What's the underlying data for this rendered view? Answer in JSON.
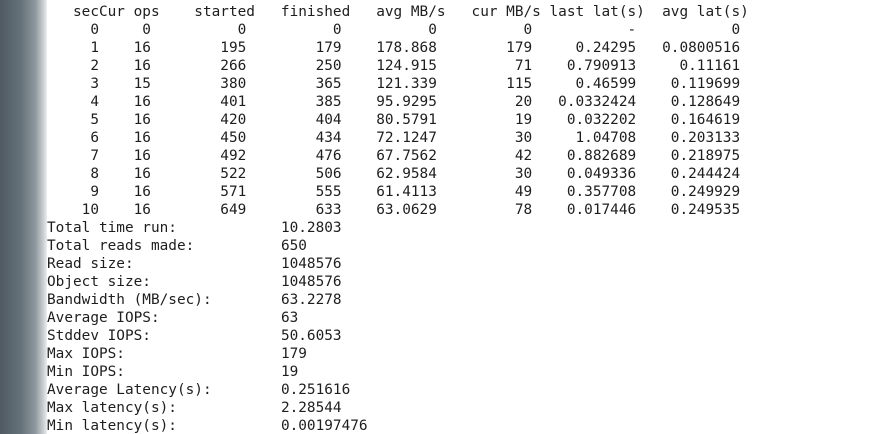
{
  "terminal": {
    "bench_table": {
      "headers": [
        "sec",
        "Cur ops",
        "started",
        "finished",
        "avg MB/s",
        "cur MB/s",
        "last lat(s)",
        "avg lat(s)"
      ],
      "rows": [
        [
          "0",
          "0",
          "0",
          "0",
          "0",
          "0",
          "-",
          "0"
        ],
        [
          "1",
          "16",
          "195",
          "179",
          "178.868",
          "179",
          "0.24295",
          "0.0800516"
        ],
        [
          "2",
          "16",
          "266",
          "250",
          "124.915",
          "71",
          "0.790913",
          "0.11161"
        ],
        [
          "3",
          "15",
          "380",
          "365",
          "121.339",
          "115",
          "0.46599",
          "0.119699"
        ],
        [
          "4",
          "16",
          "401",
          "385",
          "95.9295",
          "20",
          "0.0332424",
          "0.128649"
        ],
        [
          "5",
          "16",
          "420",
          "404",
          "80.5791",
          "19",
          "0.032202",
          "0.164619"
        ],
        [
          "6",
          "16",
          "450",
          "434",
          "72.1247",
          "30",
          "1.04708",
          "0.203133"
        ],
        [
          "7",
          "16",
          "492",
          "476",
          "67.7562",
          "42",
          "0.882689",
          "0.218975"
        ],
        [
          "8",
          "16",
          "522",
          "506",
          "62.9584",
          "30",
          "0.049336",
          "0.244424"
        ],
        [
          "9",
          "16",
          "571",
          "555",
          "61.4113",
          "49",
          "0.357708",
          "0.249929"
        ],
        [
          "10",
          "16",
          "649",
          "633",
          "63.0629",
          "78",
          "0.017446",
          "0.249535"
        ]
      ]
    },
    "summary": [
      {
        "label": "Total time run:",
        "value": "10.2803"
      },
      {
        "label": "Total reads made:",
        "value": "650"
      },
      {
        "label": "Read size:",
        "value": "1048576"
      },
      {
        "label": "Object size:",
        "value": "1048576"
      },
      {
        "label": "Bandwidth (MB/sec):",
        "value": "63.2278"
      },
      {
        "label": "Average IOPS:",
        "value": "63"
      },
      {
        "label": "Stddev IOPS:",
        "value": "50.6053"
      },
      {
        "label": "Max IOPS:",
        "value": "179"
      },
      {
        "label": "Min IOPS:",
        "value": "19"
      },
      {
        "label": "Average Latency(s):",
        "value": "0.251616"
      },
      {
        "label": "Max latency(s):",
        "value": "2.28544"
      },
      {
        "label": "Min latency(s):",
        "value": "0.00197476"
      }
    ]
  }
}
